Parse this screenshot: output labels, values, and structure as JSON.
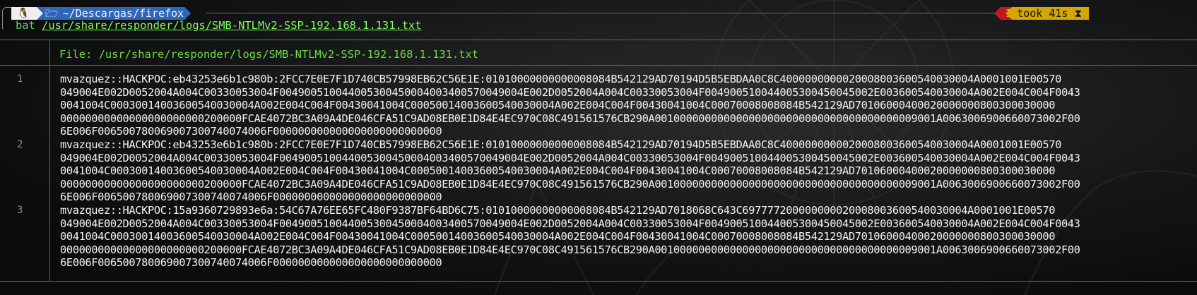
{
  "prompt": {
    "os_icon": "🐧",
    "folder_icon": "folder-open-icon",
    "path": "~/Descargas/firefox",
    "status_code": "1 ✘",
    "took": "took 41s ⧗"
  },
  "command": {
    "program": "bat",
    "argument": "/usr/share/responder/logs/SMB-NTLMv2-SSP-192.168.1.131.txt"
  },
  "bat": {
    "file_header": "File: /usr/share/responder/logs/SMB-NTLMv2-SSP-192.168.1.131.txt",
    "lines": [
      {
        "number": "1",
        "rows": [
          "mvazquez::HACKPOC:eb43253e6b1c980b:2FCC7E0E7F1D740CB57998EB62C56E1E:0101000000000000808 4B542129AD70194D5B5EBDAA0C8C4000000000020008003600540030004A0001001E00570",
          "049004E002D0052004A004C00330053004F004900510044005300450004003400570049004E002D0052004A004C00330053004F0049005100440053004500 45002E003600540030004A002E004C004F0043",
          "0041004C0003001400360054003000 4A002E004C004F00430041004C000500140036005400 30004A002E004C004F00430041004C0007000800 8084B542129AD70106000400020000000800300030000",
          "00000000000000000000000200000FCAE4072BC3A09A4DE046CFA51C9AD08EB0E1D84E4EC970C08C491561576CB290A001000000000000000000000000000000000000009001A006300690066007300 2F00",
          "6E006F006500780069007300740074006F000000000000000000000000000"
        ]
      },
      {
        "number": "2",
        "rows": [
          "mvazquez::HACKPOC:eb43253e6b1c980b:2FCC7E0E7F1D740CB57998EB62C56E1E:0101000000000000808 4B542129AD70194D5B5EBDAA0C8C4000000000020008003600540030004A0001001E00570",
          "049004E002D0052004A004C00330053004F004900510044005300450004003400570049004E002D0052004A004C00330053004F0049005100440053004500 45002E003600540030004A002E004C004F0043",
          "0041004C0003001400360054003000 4A002E004C004F00430041004C000500140036005400 30004A002E004C004F00430041004C0007000800 8084B542129AD70106000400020000000800300030000",
          "00000000000000000000000200000FCAE4072BC3A09A4DE046CFA51C9AD08EB0E1D84E4EC970C08C491561576CB290A001000000000000000000000000000000000000009001A006300690066007300 2F00",
          "6E006F006500780069007300740074006F000000000000000000000000000"
        ]
      },
      {
        "number": "3",
        "rows": [
          "mvazquez::HACKPOC:15a9360729893e6a:54C67A76EE65FC480F9387BF64BD6C75:0101000000000000808 4B542129AD7018068C643C69777720000000002000800360054003000 4A0001001E00570",
          "049004E002D0052004A004C00330053004F004900510044005300450004003400570049004E002D0052004A004C00330053004F0049005100440053004500 45002E003600540030004A002E004C004F0043",
          "0041004C0003001400360054003000 4A002E004C004F00430041004C000500140036005400 30004A002E004C004F00430041004C0007000800 8084B542129AD70106000400020000000800300030000",
          "00000000000000000000000200000FCAE4072BC3A09A4DE046CFA51C9AD08EB0E1D84E4EC970C08C491561576CB290A001000000000000000000000000000000000000009001A006300690066007300 2F00",
          "6E006F006500780069007300740074006F000000000000000000000000000"
        ]
      }
    ]
  }
}
